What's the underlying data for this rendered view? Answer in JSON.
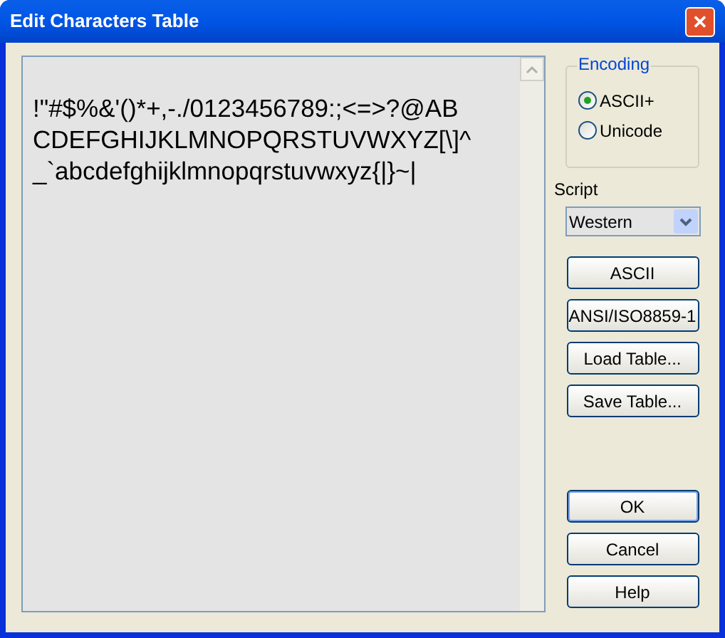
{
  "window": {
    "title": "Edit Characters Table",
    "close": "✕"
  },
  "editor": {
    "lines": [
      "!\"#$%&'()*+,-./0123456789:;<=>?@AB",
      "CDEFGHIJKLMNOPQRSTUVWXYZ[\\]^",
      "_`abcdefghijklmnopqrstuvwxyz{|}~|"
    ]
  },
  "encoding": {
    "label": "Encoding",
    "options": [
      {
        "label": "ASCII+",
        "selected": true
      },
      {
        "label": "Unicode",
        "selected": false
      }
    ]
  },
  "script": {
    "label": "Script",
    "value": "Western"
  },
  "table_buttons": [
    "ASCII",
    "ANSI/ISO8859-1",
    "Load Table...",
    "Save Table..."
  ],
  "dialog_buttons": [
    "OK",
    "Cancel",
    "Help"
  ]
}
